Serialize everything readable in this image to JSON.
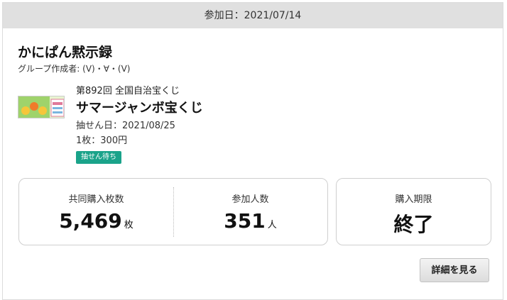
{
  "header": {
    "join_date": "参加日：2021/07/14"
  },
  "group": {
    "title": "かにぱん黙示録",
    "creator": "グループ作成者: (V)・∀・(V)"
  },
  "lottery": {
    "round": "第892回  全国自治宝くじ",
    "name": "サマージャンボ宝くじ",
    "draw_date": "抽せん日：2021/08/25",
    "price": "1枚：300円",
    "status": "抽せん待ち"
  },
  "stats": {
    "purchased_label": "共同購入枚数",
    "purchased_value": "5,469",
    "purchased_unit": "枚",
    "participants_label": "参加人数",
    "participants_value": "351",
    "participants_unit": "人",
    "period_label": "購入期限",
    "period_value": "終了"
  },
  "actions": {
    "detail_label": "詳細を見る"
  },
  "colors": {
    "status_badge": "#1aa38a",
    "header_bg": "#e0e0e0"
  }
}
